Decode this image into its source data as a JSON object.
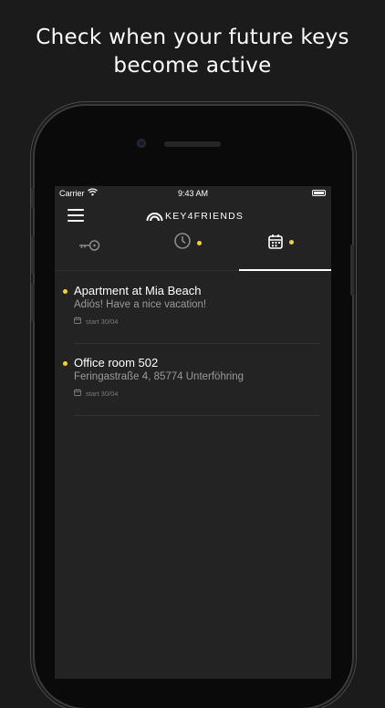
{
  "headline": {
    "line1": "Check when your future keys",
    "line2": "become active"
  },
  "status_bar": {
    "carrier": "Carrier",
    "time": "9:43 AM"
  },
  "navbar": {
    "menu_icon": "hamburger-menu-icon",
    "logo_text": "KEY4FRIENDS",
    "accent_color": "#f4d03f"
  },
  "tabs": [
    {
      "name": "keys",
      "icon": "key-icon",
      "active": false,
      "badge": false
    },
    {
      "name": "history",
      "icon": "clock-icon",
      "active": false,
      "badge": true
    },
    {
      "name": "scheduled",
      "icon": "calendar-icon",
      "active": true,
      "badge": true
    }
  ],
  "items": [
    {
      "title": "Apartment at Mia Beach",
      "subtitle": "Adiós! Have a nice vacation!",
      "meta": "start 30/04"
    },
    {
      "title": "Office room 502",
      "subtitle": "Feringastraße 4, 85774 Unterföhring",
      "meta": "start 30/04"
    }
  ]
}
